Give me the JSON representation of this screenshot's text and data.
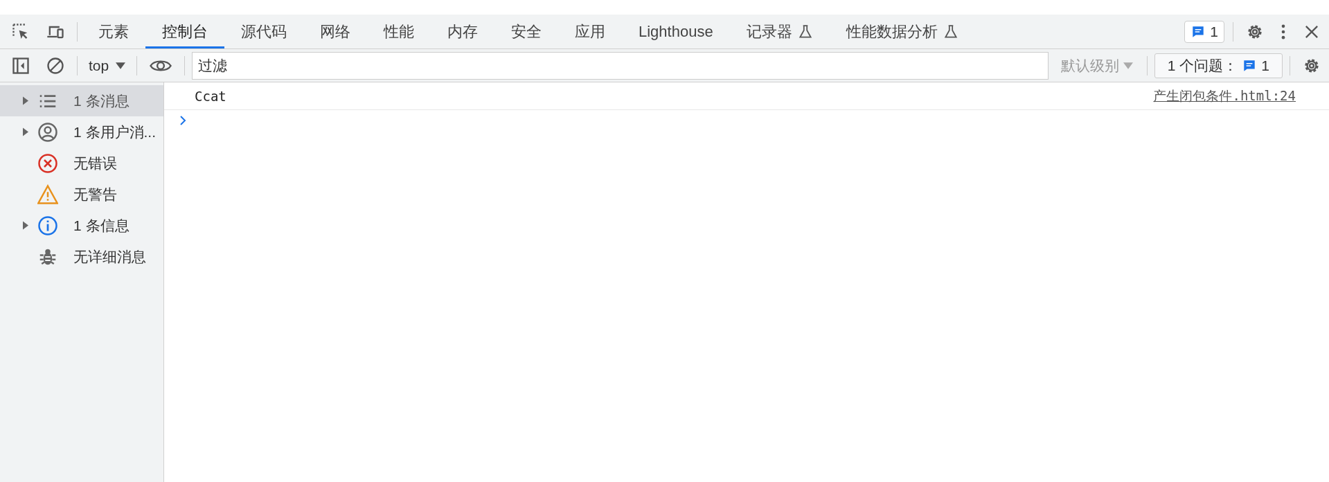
{
  "tabs": [
    {
      "label": "元素",
      "selected": false,
      "experimental": false
    },
    {
      "label": "控制台",
      "selected": true,
      "experimental": false
    },
    {
      "label": "源代码",
      "selected": false,
      "experimental": false
    },
    {
      "label": "网络",
      "selected": false,
      "experimental": false
    },
    {
      "label": "性能",
      "selected": false,
      "experimental": false
    },
    {
      "label": "内存",
      "selected": false,
      "experimental": false
    },
    {
      "label": "安全",
      "selected": false,
      "experimental": false
    },
    {
      "label": "应用",
      "selected": false,
      "experimental": false
    },
    {
      "label": "Lighthouse",
      "selected": false,
      "experimental": false
    },
    {
      "label": "记录器",
      "selected": false,
      "experimental": true
    },
    {
      "label": "性能数据分析",
      "selected": false,
      "experimental": true
    }
  ],
  "issues_badge": "1",
  "toolbar": {
    "context": "top",
    "filter": {
      "placeholder": "过滤"
    },
    "level": "默认级别",
    "issues_label": "1 个问题：",
    "issues_count": "1"
  },
  "sidebar": {
    "items": [
      {
        "kind": "messages",
        "label": "1 条消息",
        "expandable": true,
        "selected": true
      },
      {
        "kind": "user",
        "label": "1 条用户消...",
        "expandable": true,
        "selected": false
      },
      {
        "kind": "error",
        "label": "无错误",
        "expandable": false,
        "selected": false
      },
      {
        "kind": "warning",
        "label": "无警告",
        "expandable": false,
        "selected": false
      },
      {
        "kind": "info",
        "label": "1 条信息",
        "expandable": true,
        "selected": false
      },
      {
        "kind": "verbose",
        "label": "无详细消息",
        "expandable": false,
        "selected": false
      }
    ]
  },
  "console": {
    "messages": [
      {
        "text": "Ccat",
        "source": "产生闭包条件.html:24"
      }
    ]
  }
}
